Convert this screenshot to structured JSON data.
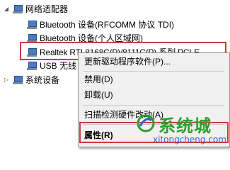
{
  "tree": {
    "category_label": "网络适配器",
    "children": [
      {
        "label": "Bluetooth 设备(RFCOMM 协议 TDI)"
      },
      {
        "label": "Bluetooth 设备(个人区域网)"
      },
      {
        "label": "Realtek RTL8168C(P)/8111C(P) 系列 PCI-E"
      },
      {
        "label": "USB 无线"
      }
    ],
    "next_category_label": "系统设备"
  },
  "context_menu": {
    "items": [
      {
        "label": "更新驱动程序软件(P)..."
      },
      {
        "label": "禁用(D)"
      },
      {
        "label": "卸载(U)"
      },
      {
        "label": "扫描检测硬件改动(A)"
      },
      {
        "label": "属性(R)"
      }
    ]
  },
  "watermark": {
    "brand": "系统城",
    "url": "xitongcheng.com"
  },
  "colors": {
    "highlight_box": "#d03a3a",
    "watermark_green": "#2e9e2e",
    "watermark_blue": "#1f6ec7"
  }
}
